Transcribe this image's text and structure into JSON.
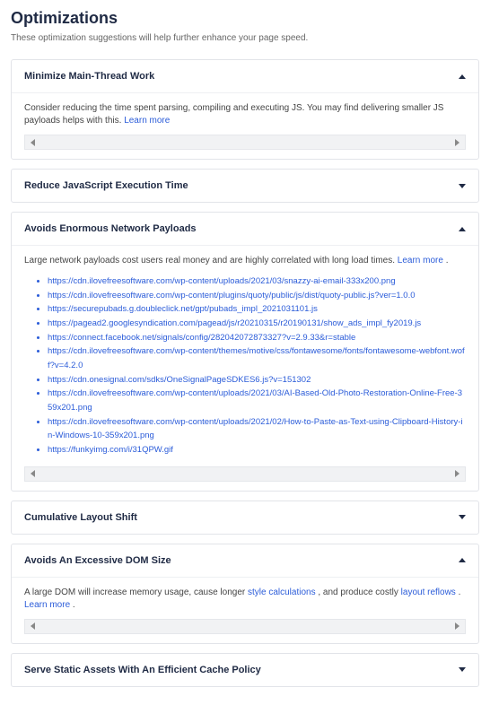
{
  "page_title": "Optimizations",
  "page_subtitle": "These optimization suggestions will help further enhance your page speed.",
  "learn_more_label": "Learn more",
  "panels": {
    "minimize_main_thread": {
      "title": "Minimize Main-Thread Work",
      "expanded": true,
      "description": "Consider reducing the time spent parsing, compiling and executing JS. You may find delivering smaller JS payloads helps with this."
    },
    "reduce_js": {
      "title": "Reduce JavaScript Execution Time",
      "expanded": false
    },
    "avoid_payloads": {
      "title": "Avoids Enormous Network Payloads",
      "expanded": true,
      "description": "Large network payloads cost users real money and are highly correlated with long load times.",
      "items": [
        "https://cdn.ilovefreesoftware.com/wp-content/uploads/2021/03/snazzy-ai-email-333x200.png",
        "https://cdn.ilovefreesoftware.com/wp-content/plugins/quoty/public/js/dist/quoty-public.js?ver=1.0.0",
        "https://securepubads.g.doubleclick.net/gpt/pubads_impl_2021031101.js",
        "https://pagead2.googlesyndication.com/pagead/js/r20210315/r20190131/show_ads_impl_fy2019.js",
        "https://connect.facebook.net/signals/config/282042072873327?v=2.9.33&r=stable",
        "https://cdn.ilovefreesoftware.com/wp-content/themes/motive/css/fontawesome/fonts/fontawesome-webfont.woff?v=4.2.0",
        "https://cdn.onesignal.com/sdks/OneSignalPageSDKES6.js?v=151302",
        "https://cdn.ilovefreesoftware.com/wp-content/uploads/2021/03/AI-Based-Old-Photo-Restoration-Online-Free-359x201.png",
        "https://cdn.ilovefreesoftware.com/wp-content/uploads/2021/02/How-to-Paste-as-Text-using-Clipboard-History-in-Windows-10-359x201.png",
        "https://funkyimg.com/i/31QPW.gif"
      ]
    },
    "cls": {
      "title": "Cumulative Layout Shift",
      "expanded": false
    },
    "dom_size": {
      "title": "Avoids An Excessive DOM Size",
      "expanded": true,
      "description_parts": {
        "p1": "A large DOM will increase memory usage, cause longer ",
        "link1": "style calculations",
        "p2": " , and produce costly ",
        "link2": "layout reflows",
        "p3": " . "
      }
    },
    "cache_policy": {
      "title": "Serve Static Assets With An Efficient Cache Policy",
      "expanded": false
    }
  }
}
